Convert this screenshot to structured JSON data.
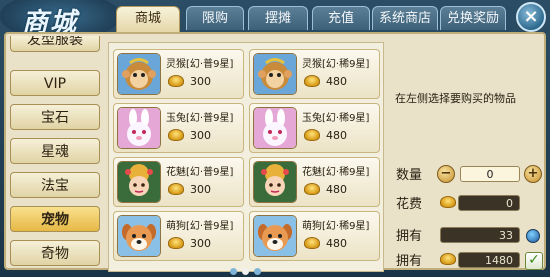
{
  "title": "商城",
  "tabs": [
    {
      "label": "商城",
      "active": true
    },
    {
      "label": "限购",
      "active": false
    },
    {
      "label": "摆摊",
      "active": false
    },
    {
      "label": "充值",
      "active": false
    },
    {
      "label": "系统商店",
      "active": false
    },
    {
      "label": "兑换奖励",
      "active": false
    }
  ],
  "close_label": "×",
  "categories": [
    {
      "label": "发型服装",
      "active": false
    },
    {
      "label": "VIP",
      "active": false
    },
    {
      "label": "宝石",
      "active": false
    },
    {
      "label": "星魂",
      "active": false
    },
    {
      "label": "法宝",
      "active": false
    },
    {
      "label": "宠物",
      "active": true
    },
    {
      "label": "奇物",
      "active": false
    }
  ],
  "items": [
    {
      "name": "灵猴[幻·普9星]",
      "price": "300",
      "pet": "monkey"
    },
    {
      "name": "灵猴[幻·稀9星]",
      "price": "480",
      "pet": "monkey"
    },
    {
      "name": "玉兔[幻·普9星]",
      "price": "300",
      "pet": "rabbit"
    },
    {
      "name": "玉兔[幻·稀9星]",
      "price": "480",
      "pet": "rabbit"
    },
    {
      "name": "花魅[幻·普9星]",
      "price": "300",
      "pet": "fairy"
    },
    {
      "name": "花魅[幻·稀9星]",
      "price": "480",
      "pet": "fairy"
    },
    {
      "name": "萌狗[幻·普9星]",
      "price": "300",
      "pet": "dog"
    },
    {
      "name": "萌狗[幻·稀9星]",
      "price": "480",
      "pet": "dog"
    }
  ],
  "info": {
    "hint": "在左侧选择要购买的物品",
    "quantity_label": "数量",
    "quantity_value": "0",
    "minus_label": "−",
    "plus_label": "+",
    "cost_label": "花费",
    "cost_value": "0",
    "own1_label": "拥有",
    "own1_value": "33",
    "own2_label": "拥有",
    "own2_value": "1480",
    "confirm_label": "✓"
  },
  "page_dots": {
    "count": 3,
    "active_index": 1
  },
  "colors": {
    "accent": "#e6b845",
    "panel": "#e9e2c9",
    "frame": "#1f3f57"
  }
}
